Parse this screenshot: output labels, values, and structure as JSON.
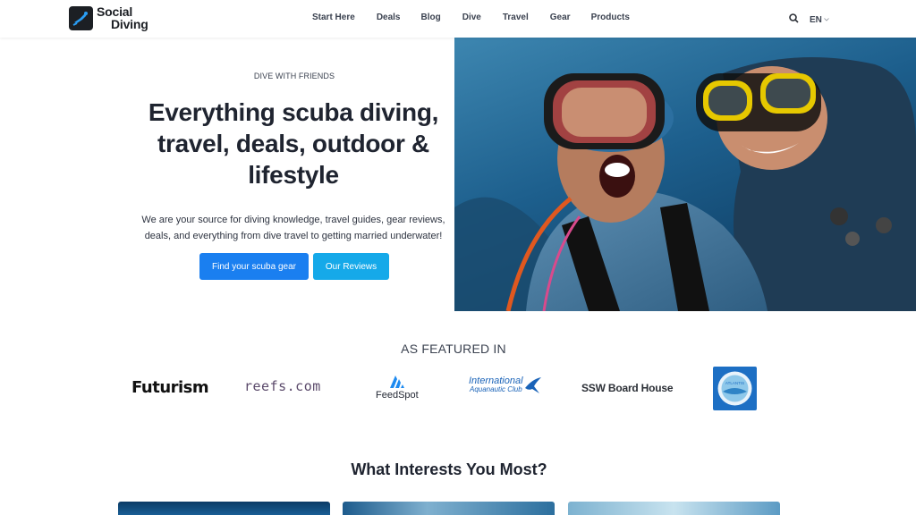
{
  "nav": {
    "logo_line1": "Social",
    "logo_line2": "Diving",
    "items": [
      "Start Here",
      "Deals",
      "Blog",
      "Dive",
      "Travel",
      "Gear",
      "Products"
    ],
    "search_icon": "search-icon",
    "language": "EN"
  },
  "hero": {
    "eyebrow": "DIVE WITH FRIENDS",
    "headline": "Everything scuba diving, travel, deals, outdoor & lifestyle",
    "subtext": "We are your source for diving knowledge, travel guides, gear reviews, deals, and everything from dive travel to getting married underwater!",
    "primary_button": "Find your scuba gear",
    "secondary_button": "Our Reviews",
    "image": "two divers underwater selfie"
  },
  "featured": {
    "title": "AS FEATURED IN",
    "logos": {
      "futurism": "Futurism",
      "reefs": "reefs.com",
      "feedspot": "FeedSpot",
      "iac_line1": "International",
      "iac_line2": "Aquanautic Club",
      "ssw": "SSW Board House",
      "atlantis": "ATLANTIS"
    }
  },
  "interests": {
    "title": "What Interests You Most?"
  },
  "colors": {
    "primary_button": "#1a7ff0",
    "secondary_button": "#15a9e9",
    "text_dark": "#1f2430"
  }
}
